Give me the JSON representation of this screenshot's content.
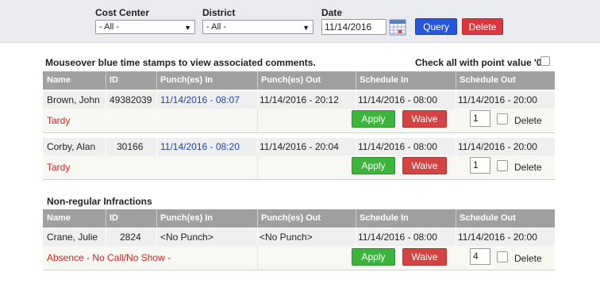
{
  "filters": {
    "cost_center": {
      "label": "Cost Center",
      "value": "- All -"
    },
    "district": {
      "label": "District",
      "value": "- All -"
    },
    "date": {
      "label": "Date",
      "value": "11/14/2016"
    },
    "query_label": "Query",
    "delete_label": "Delete"
  },
  "instructions": "Mouseover blue time stamps to view associated comments.",
  "check_all_label": "Check all with point value '0'",
  "columns": [
    "Name",
    "ID",
    "Punch(es) In",
    "Punch(es) Out",
    "Schedule In",
    "Schedule Out"
  ],
  "records": [
    {
      "name": "Brown, John",
      "id": "49382039",
      "punch_in": "11/14/2016 - 08:07",
      "punch_out": "11/14/2016 - 20:12",
      "sched_in": "11/14/2016 - 08:00",
      "sched_out": "11/14/2016 - 20:00",
      "infraction": "Tardy",
      "points": "1"
    },
    {
      "name": "Corby, Alan",
      "id": "30166",
      "punch_in": "11/14/2016 - 08:20",
      "punch_out": "11/14/2016 - 20:04",
      "sched_in": "11/14/2016 - 08:00",
      "sched_out": "11/14/2016 - 20:00",
      "infraction": "Tardy",
      "points": "1"
    }
  ],
  "nonregular_title": "Non-regular Infractions",
  "nonregular": [
    {
      "name": "Crane, Julie",
      "id": "2824",
      "punch_in": "<No Punch>",
      "punch_out": "<No Punch>",
      "sched_in": "11/14/2016 - 08:00",
      "sched_out": "11/14/2016 - 20:00",
      "infraction": "Absence - No Call/No Show -",
      "points": "4"
    }
  ],
  "apply_label": "Apply",
  "waive_label": "Waive",
  "delete_row_label": "Delete",
  "colors": {
    "header_gray": "#a0a0a0",
    "link_blue": "#1a3fcc",
    "infraction_red": "#cc2222",
    "apply_green": "#3db43d",
    "waive_red": "#d24343",
    "query_blue": "#2557d6"
  }
}
